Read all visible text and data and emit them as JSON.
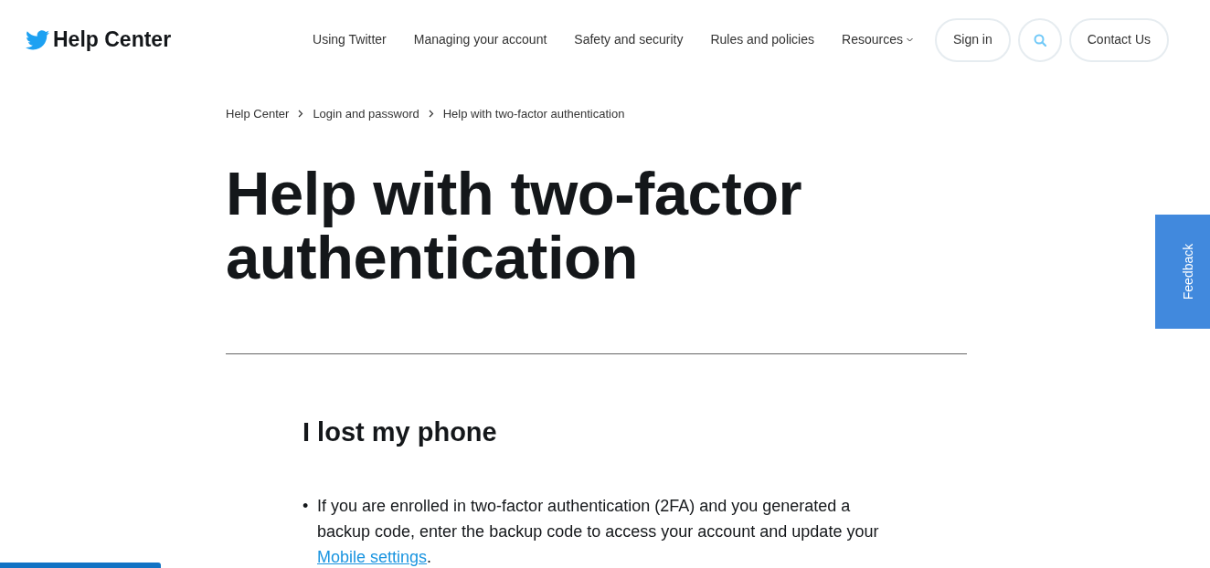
{
  "header": {
    "logo_text": "Help Center",
    "nav": [
      {
        "label": "Using Twitter",
        "dropdown": false
      },
      {
        "label": "Managing your account",
        "dropdown": false
      },
      {
        "label": "Safety and security",
        "dropdown": false
      },
      {
        "label": "Rules and policies",
        "dropdown": false
      },
      {
        "label": "Resources",
        "dropdown": true
      }
    ],
    "sign_in": "Sign in",
    "contact": "Contact Us"
  },
  "breadcrumb": [
    "Help Center",
    "Login and password",
    "Help with two-factor authentication"
  ],
  "title": "Help with two-factor authentication",
  "section": {
    "heading": "I lost my phone",
    "bullets": [
      {
        "marker": "•",
        "before": "If you are enrolled in two-factor authentication (2FA) and you generated a backup code, enter the backup code to access your account and update your ",
        "link": "Mobile settings",
        "after": "."
      }
    ]
  },
  "feedback": "Feedback"
}
